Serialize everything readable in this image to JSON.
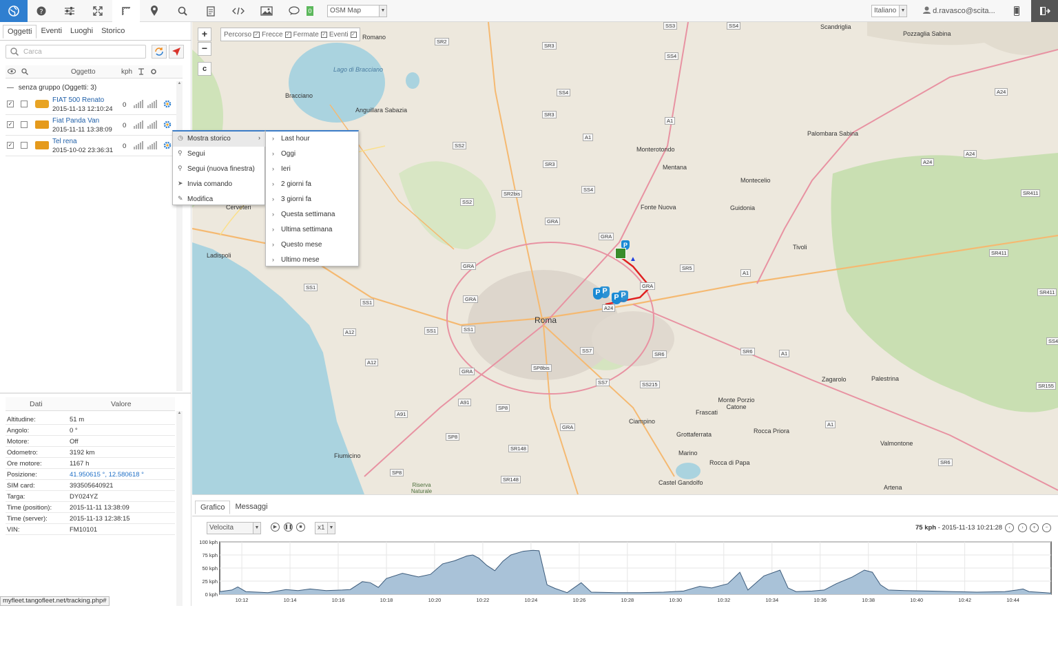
{
  "toolbar": {
    "msg_count": "0",
    "map_select": "OSM Map",
    "lang_select": "Italiano",
    "user": "d.ravasco@scita..."
  },
  "left": {
    "tabs": [
      "Oggetti",
      "Eventi",
      "Luoghi",
      "Storico"
    ],
    "search_placeholder": "Carca",
    "list_header": {
      "object": "Oggetto",
      "speed": "kph"
    },
    "group": "senza gruppo (Oggetti: 3)",
    "objects": [
      {
        "name": "FIAT 500 Renato",
        "time": "2015-11-13 12:10:24",
        "speed": "0"
      },
      {
        "name": "Fiat Panda Van",
        "time": "2015-11-11 13:38:09",
        "speed": "0"
      },
      {
        "name": "Tel rena",
        "time": "2015-10-02 23:36:31",
        "speed": "0"
      }
    ],
    "data_header": {
      "key": "Dati",
      "value": "Valore"
    },
    "data_rows": [
      {
        "k": "Altitudine:",
        "v": "51 m"
      },
      {
        "k": "Angolo:",
        "v": "0 °"
      },
      {
        "k": "Motore:",
        "v": "Off"
      },
      {
        "k": "Odometro:",
        "v": "3192 km"
      },
      {
        "k": "Ore motore:",
        "v": "1167 h"
      },
      {
        "k": "Posizione:",
        "v": "41.950615 °, 12.580618 °"
      },
      {
        "k": "SIM card:",
        "v": "393505640921"
      },
      {
        "k": "Targa:",
        "v": "DY024YZ"
      },
      {
        "k": "Time (position):",
        "v": "2015-11-11 13:38:09"
      },
      {
        "k": "Time (server):",
        "v": "2015-11-13 12:38:15"
      },
      {
        "k": "VIN:",
        "v": "FM10101"
      }
    ],
    "status_url": "myfleet.tangofleet.net/tracking.php#"
  },
  "map": {
    "layers": [
      {
        "label": "Percorso",
        "checked": true
      },
      {
        "label": "Frecce",
        "checked": true
      },
      {
        "label": "Fermate",
        "checked": true
      },
      {
        "label": "Eventi",
        "checked": true
      }
    ],
    "zoom_in": "+",
    "zoom_out": "−",
    "c_button": "c",
    "labels": [
      "Roma",
      "Bracciano",
      "Anguillara Sabazia",
      "Lago di Bracciano",
      "Monterotondo",
      "Mentana",
      "Fonte Nuova",
      "Guidonia",
      "Montecelio",
      "Palombara Sabina",
      "Tivoli",
      "Ladispoli",
      "Cerveteri",
      "Fiumicino",
      "Frascati",
      "Grottaferrata",
      "Ciampino",
      "Marino",
      "Castel Gandolfo",
      "Rocca di Papa",
      "Rocca Priora",
      "Monte Porzio Catone",
      "Zagarolo",
      "Palestrina",
      "Valmontone",
      "Artena",
      "Scandriglia",
      "Pozzaglia Sabina",
      "Romano",
      "Riserva Naturale"
    ]
  },
  "context_menu": {
    "items": [
      {
        "label": "Mostra storico",
        "icon": "clock-icon"
      },
      {
        "label": "Segui",
        "icon": "search-icon"
      },
      {
        "label": "Segui (nuova finestra)",
        "icon": "search-icon"
      },
      {
        "label": "Invia comando",
        "icon": "send-icon"
      },
      {
        "label": "Modifica",
        "icon": "pencil-icon"
      }
    ],
    "sub_items": [
      "Last hour",
      "Oggi",
      "Ieri",
      "2 giorni fa",
      "3 giorni fa",
      "Questa settimana",
      "Ultima settimana",
      "Questo mese",
      "Ultimo mese"
    ]
  },
  "bottom": {
    "tabs": [
      "Grafico",
      "Messaggi"
    ],
    "metric_select": "Velocita",
    "speed_select": "x1",
    "info_speed": "75 kph",
    "info_time": " - 2015-11-13 10:21:28"
  },
  "chart_data": {
    "type": "area",
    "title": "",
    "ylabel": "",
    "y_ticks": [
      "100 kph",
      "75 kph",
      "50 kph",
      "25 kph",
      "0 kph"
    ],
    "ylim": [
      0,
      100
    ],
    "x_ticks": [
      "10:12",
      "10:14",
      "10:16",
      "10:18",
      "10:20",
      "10:22",
      "10:24",
      "10:26",
      "10:28",
      "10:30",
      "10:32",
      "10:34",
      "10:36",
      "10:38",
      "10:40",
      "10:42",
      "10:44"
    ],
    "x_minutes_range": [
      "10:11:05",
      "10:45:35"
    ],
    "series": [
      {
        "color": "#7fa3c4",
        "points": [
          [
            "10:11:05",
            5
          ],
          [
            "10:11:35",
            8
          ],
          [
            "10:11:50",
            14
          ],
          [
            "10:12:10",
            5
          ],
          [
            "10:13:05",
            3
          ],
          [
            "10:13:50",
            9
          ],
          [
            "10:14:20",
            7
          ],
          [
            "10:14:50",
            10
          ],
          [
            "10:15:30",
            7
          ],
          [
            "10:16:10",
            8
          ],
          [
            "10:16:30",
            9
          ],
          [
            "10:17:00",
            24
          ],
          [
            "10:17:20",
            22
          ],
          [
            "10:17:40",
            13
          ],
          [
            "10:18:00",
            30
          ],
          [
            "10:18:40",
            40
          ],
          [
            "10:19:20",
            33
          ],
          [
            "10:19:50",
            38
          ],
          [
            "10:20:20",
            58
          ],
          [
            "10:20:50",
            64
          ],
          [
            "10:21:20",
            73
          ],
          [
            "10:21:35",
            75
          ],
          [
            "10:21:50",
            69
          ],
          [
            "10:22:10",
            55
          ],
          [
            "10:22:30",
            45
          ],
          [
            "10:22:50",
            63
          ],
          [
            "10:23:10",
            75
          ],
          [
            "10:23:40",
            82
          ],
          [
            "10:24:05",
            84
          ],
          [
            "10:24:20",
            83
          ],
          [
            "10:24:40",
            18
          ],
          [
            "10:25:00",
            11
          ],
          [
            "10:25:30",
            3
          ],
          [
            "10:26:05",
            22
          ],
          [
            "10:26:30",
            4
          ],
          [
            "10:27:30",
            3
          ],
          [
            "10:28:30",
            3
          ],
          [
            "10:29:30",
            4
          ],
          [
            "10:30:20",
            6
          ],
          [
            "10:31:00",
            15
          ],
          [
            "10:31:30",
            12
          ],
          [
            "10:32:10",
            20
          ],
          [
            "10:32:40",
            42
          ],
          [
            "10:33:00",
            8
          ],
          [
            "10:33:40",
            35
          ],
          [
            "10:34:20",
            46
          ],
          [
            "10:34:40",
            12
          ],
          [
            "10:35:00",
            5
          ],
          [
            "10:35:40",
            6
          ],
          [
            "10:36:10",
            8
          ],
          [
            "10:36:40",
            20
          ],
          [
            "10:37:20",
            33
          ],
          [
            "10:37:50",
            46
          ],
          [
            "10:38:10",
            42
          ],
          [
            "10:38:30",
            18
          ],
          [
            "10:38:50",
            8
          ],
          [
            "10:39:30",
            7
          ],
          [
            "10:40:30",
            6
          ],
          [
            "10:41:30",
            5
          ],
          [
            "10:42:30",
            4
          ],
          [
            "10:43:40",
            5
          ],
          [
            "10:44:10",
            8
          ],
          [
            "10:44:25",
            10
          ],
          [
            "10:44:40",
            5
          ],
          [
            "10:45:20",
            3
          ],
          [
            "10:45:35",
            2
          ]
        ]
      }
    ]
  }
}
